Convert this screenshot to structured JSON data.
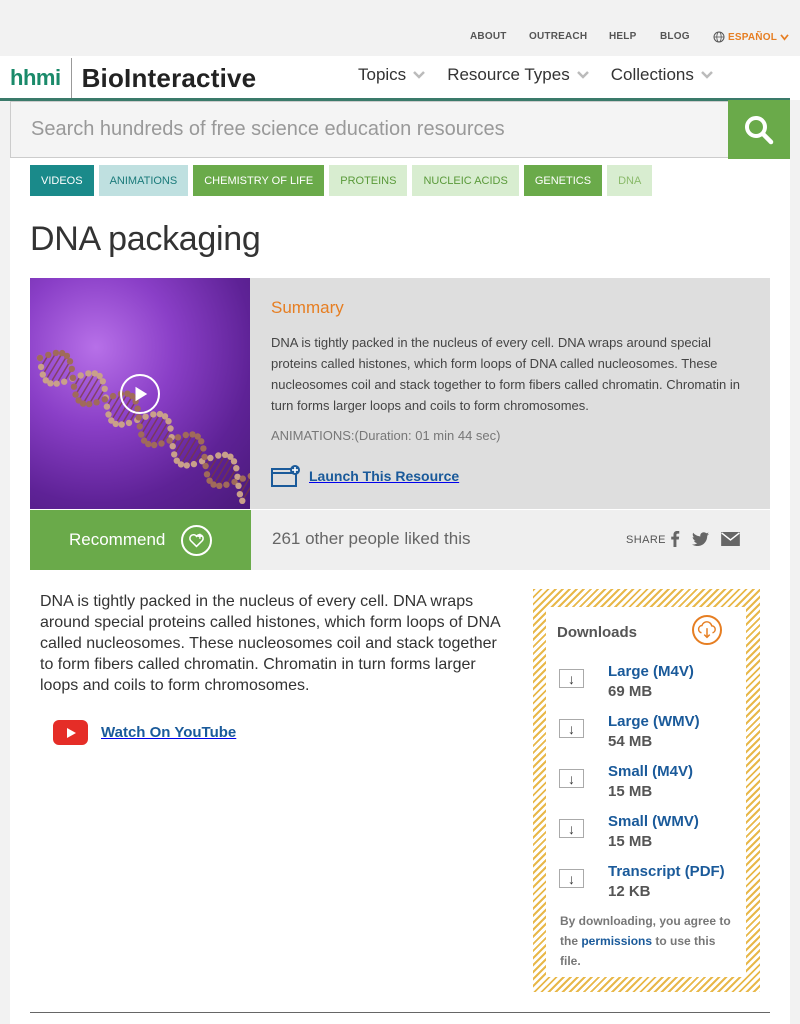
{
  "topnav": {
    "about": "ABOUT",
    "outreach": "OUTREACH",
    "help": "HELP",
    "blog": "BLOG",
    "language": "ESPAÑOL"
  },
  "logo": {
    "org": "hhmi",
    "product": "BioInteractive"
  },
  "mainnav": {
    "topics": "Topics",
    "resource_types": "Resource Types",
    "collections": "Collections"
  },
  "search": {
    "placeholder": "Search hundreds of free science education resources"
  },
  "tags": [
    {
      "label": "VIDEOS",
      "bg": "#1a8a8a",
      "color": "#ffffff"
    },
    {
      "label": "ANIMATIONS",
      "bg": "#bfe0e0",
      "color": "#1a7a7a"
    },
    {
      "label": "CHEMISTRY OF LIFE",
      "bg": "#6aaa4a",
      "color": "#ffffff"
    },
    {
      "label": "PROTEINS",
      "bg": "#d8edd0",
      "color": "#5a9a3a"
    },
    {
      "label": "NUCLEIC ACIDS",
      "bg": "#d8edd0",
      "color": "#5a9a3a"
    },
    {
      "label": "GENETICS",
      "bg": "#6aaa4a",
      "color": "#ffffff"
    },
    {
      "label": "DNA",
      "bg": "#d8edd0",
      "color": "#8aba6a"
    }
  ],
  "page": {
    "title": "DNA packaging"
  },
  "summary": {
    "heading": "Summary",
    "text": "DNA is tightly packed in the nucleus of every cell. DNA wraps around special proteins called histones, which form loops of DNA called nucleosomes. These nucleosomes coil and stack together to form fibers called chromatin. Chromatin in turn forms larger loops and coils to form chromosomes.",
    "meta": "ANIMATIONS:(Duration: 01 min 44 sec)",
    "launch": "Launch This Resource"
  },
  "social": {
    "recommend": "Recommend",
    "likes": "261 other people liked this",
    "share": "SHARE"
  },
  "body": {
    "text": "DNA is tightly packed in the nucleus of every cell. DNA wraps around special proteins called histones, which form loops of DNA called nucleosomes. These nucleosomes coil and stack together to form fibers called chromatin. Chromatin in turn forms larger loops and coils to form chromosomes.",
    "youtube": "Watch On YouTube"
  },
  "downloads": {
    "heading": "Downloads",
    "items": [
      {
        "name": "Large (M4V)",
        "size": "69 MB"
      },
      {
        "name": "Large (WMV)",
        "size": "54 MB"
      },
      {
        "name": "Small (M4V)",
        "size": "15 MB"
      },
      {
        "name": "Small (WMV)",
        "size": "15 MB"
      },
      {
        "name": "Transcript (PDF)",
        "size": "12 KB"
      }
    ],
    "note_before": "By downloading, you agree to the ",
    "note_link": "permissions",
    "note_after": " to use this file."
  },
  "colors": {
    "accent_green": "#6aaa4a",
    "accent_orange": "#e67e22",
    "link_blue": "#1a5a9a"
  }
}
